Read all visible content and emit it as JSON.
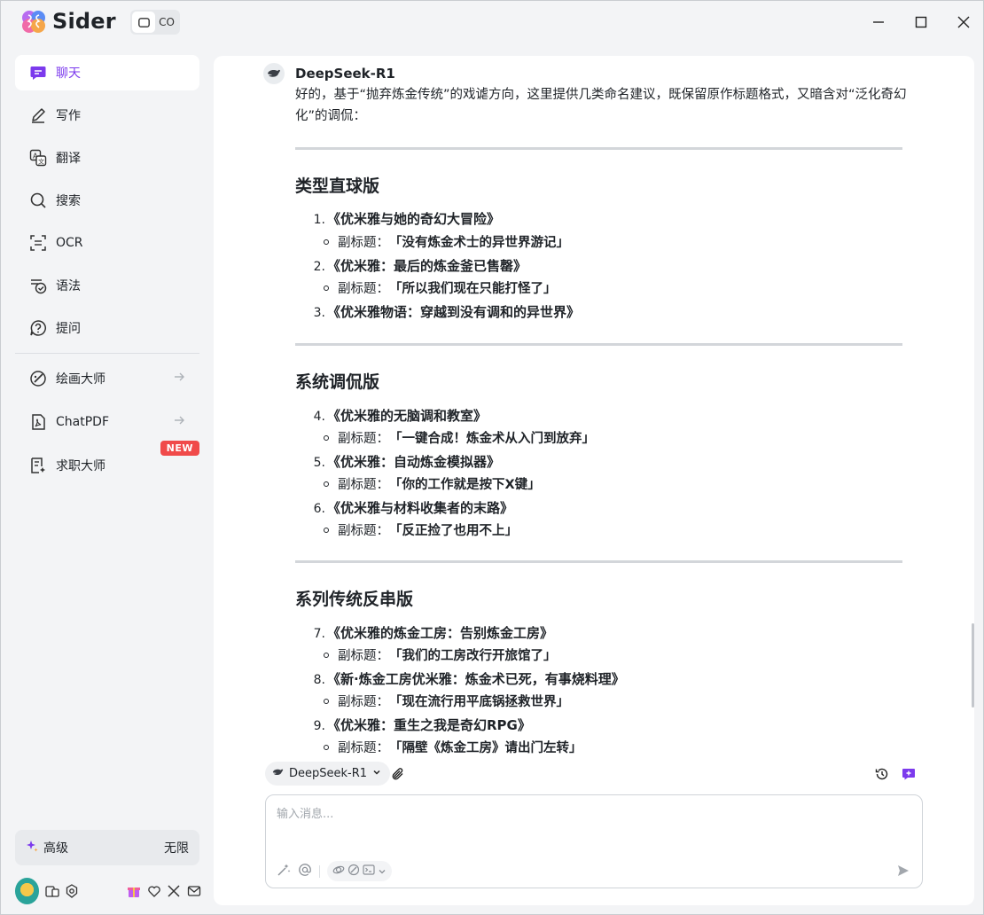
{
  "app": {
    "name": "Sider",
    "view_toggle": [
      "",
      "CO"
    ]
  },
  "sidebar": {
    "items": [
      {
        "label": "聊天",
        "icon": "chat-icon",
        "active": true
      },
      {
        "label": "写作",
        "icon": "pen-icon"
      },
      {
        "label": "翻译",
        "icon": "translate-icon"
      },
      {
        "label": "搜索",
        "icon": "search-icon"
      },
      {
        "label": "OCR",
        "icon": "ocr-scan-icon"
      },
      {
        "label": "语法",
        "icon": "grammar-check-icon"
      },
      {
        "label": "提问",
        "icon": "question-icon"
      }
    ],
    "tools": [
      {
        "label": "绘画大师",
        "icon": "paint-icon",
        "has_arrow": true
      },
      {
        "label": "ChatPDF",
        "icon": "pdf-icon",
        "has_arrow": true
      },
      {
        "label": "求职大师",
        "icon": "resume-icon",
        "badge": "NEW"
      }
    ],
    "plan": {
      "tier": "高级",
      "limit": "无限"
    }
  },
  "chat": {
    "bot_name": "DeepSeek-R1",
    "intro": "好的，基于“抛弃炼金传统”的戏谑方向，这里提供几类命名建议，既保留原作标题格式，又暗含对“泛化奇幻化”的调侃：",
    "sections": [
      {
        "title": "类型直球版",
        "items": [
          {
            "num": "1.",
            "title": "《优米雅与她的奇幻大冒险》",
            "sub_label": "副标题：",
            "sub": "「没有炼金术士的异世界游记」"
          },
          {
            "num": "2.",
            "title": "《优米雅：最后的炼金釜已售罄》",
            "sub_label": "副标题：",
            "sub": "「所以我们现在只能打怪了」"
          },
          {
            "num": "3.",
            "title": "《优米雅物语：穿越到没有调和的异世界》"
          }
        ]
      },
      {
        "title": "系统调侃版",
        "items": [
          {
            "num": "4.",
            "title": "《优米雅的无脑调和教室》",
            "sub_label": "副标题：",
            "sub": "「一键合成！炼金术从入门到放弃」"
          },
          {
            "num": "5.",
            "title": "《优米雅：自动炼金模拟器》",
            "sub_label": "副标题：",
            "sub": "「你的工作就是按下X键」"
          },
          {
            "num": "6.",
            "title": "《优米雅与材料收集者的末路》",
            "sub_label": "副标题：",
            "sub": "「反正捡了也用不上」"
          }
        ]
      },
      {
        "title": "系列传统反串版",
        "items": [
          {
            "num": "7.",
            "title": "《优米雅的炼金工房：告别炼金工房》",
            "sub_label": "副标题：",
            "sub": "「我们的工房改行开旅馆了」"
          },
          {
            "num": "8.",
            "title": "《新·炼金工房优米雅：炼金术已死，有事烧料理》",
            "sub_label": "副标题：",
            "sub": "「现在流行用平底锅拯救世界」"
          },
          {
            "num": "9.",
            "title": "《优米雅：重生之我是奇幻RPG》",
            "sub_label": "副标题：",
            "sub": "「隔壁《炼金工房》请出门左转」"
          }
        ]
      }
    ]
  },
  "composer": {
    "model": "DeepSeek-R1",
    "placeholder": "输入消息..."
  },
  "colors": {
    "accent": "#7c3aed",
    "badge": "#f04a4a",
    "background": "#f3f4f6"
  }
}
